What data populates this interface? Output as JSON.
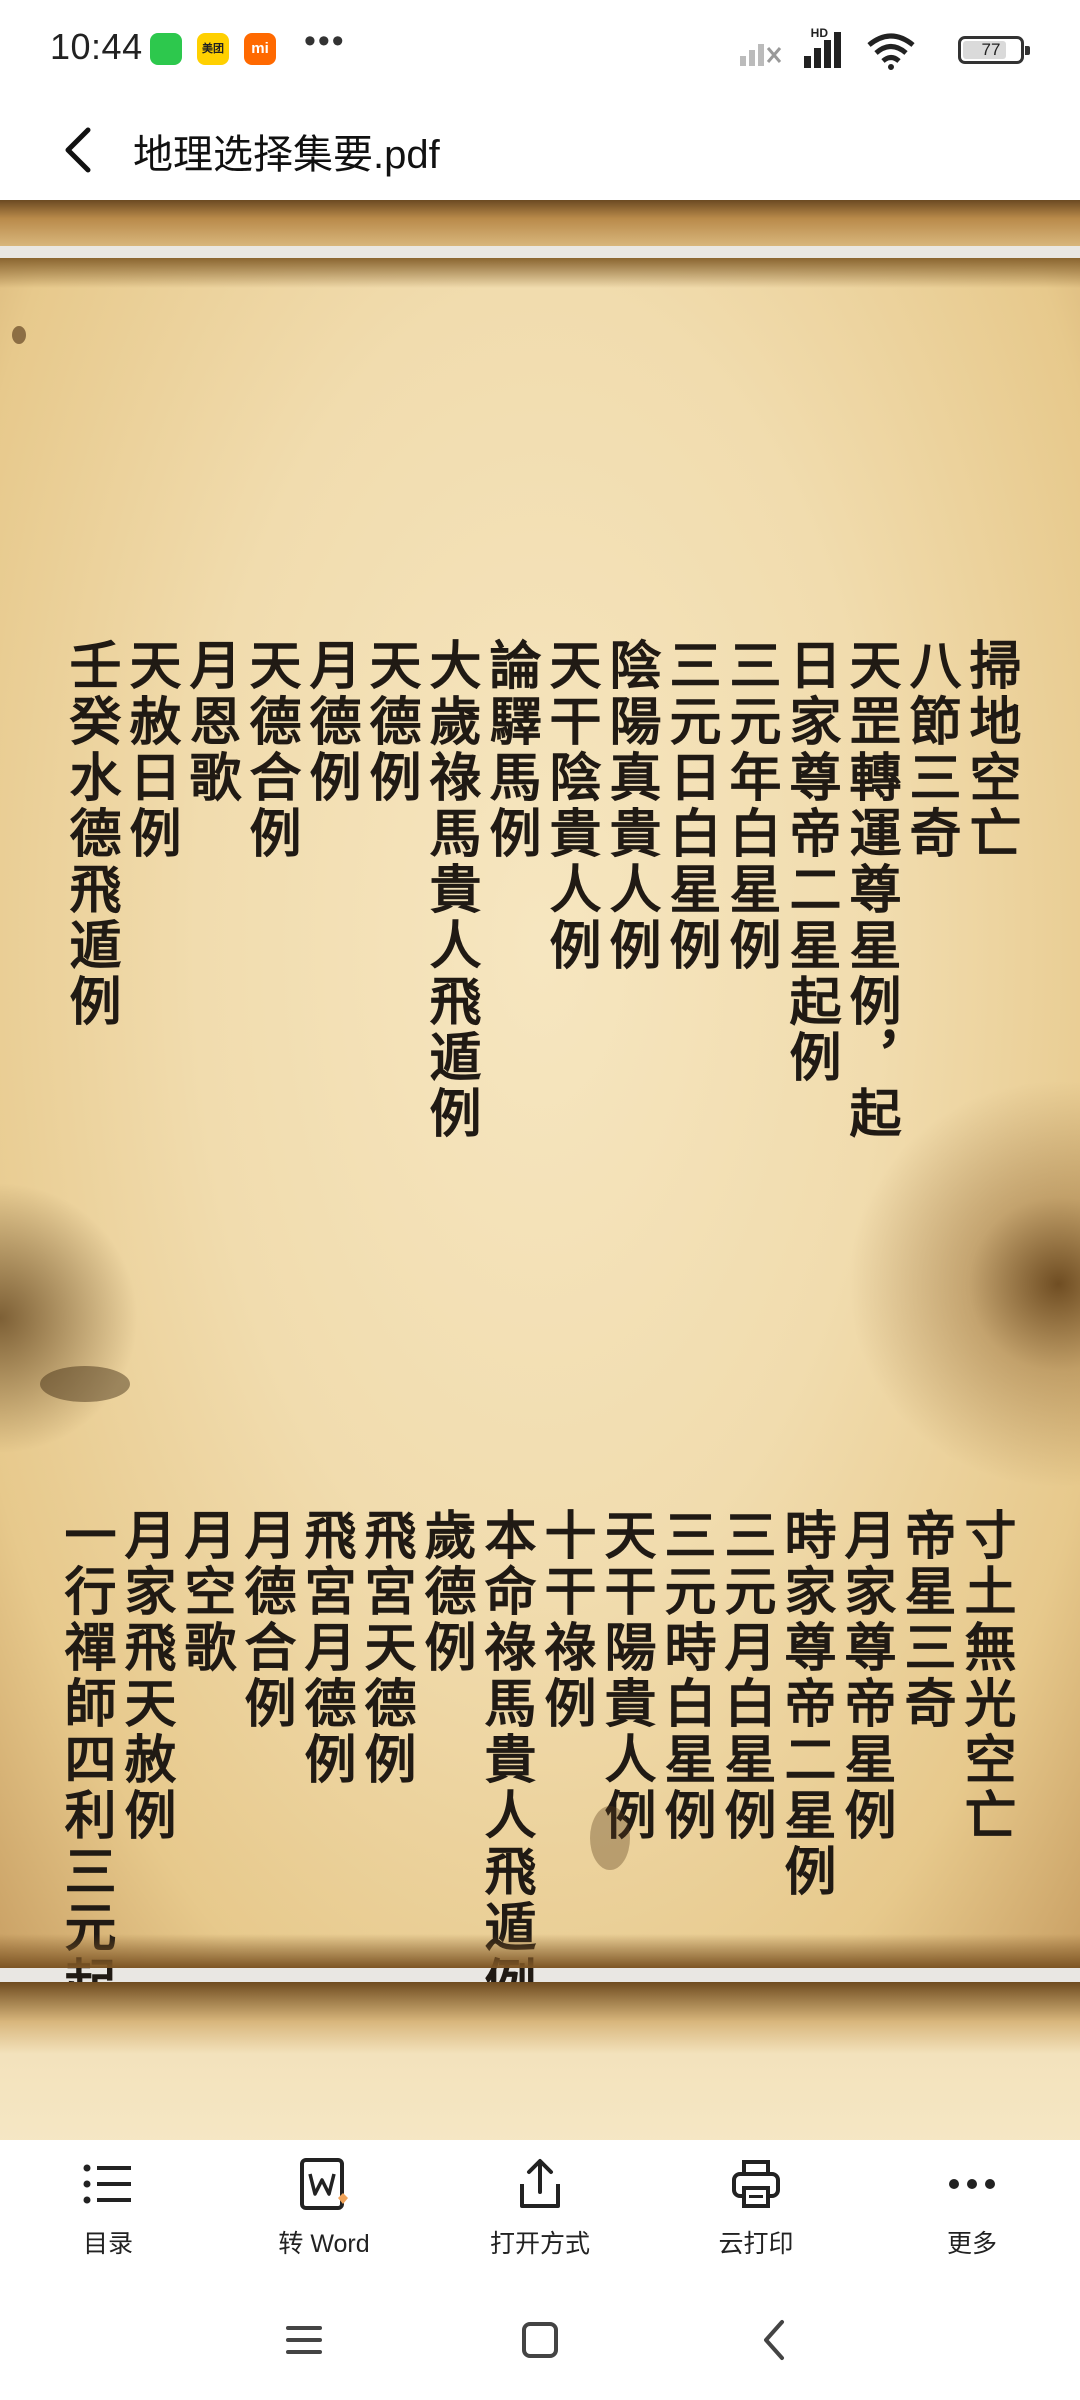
{
  "status_bar": {
    "time": "10:44",
    "app_badges": [
      {
        "name": "wechat-icon",
        "text": ""
      },
      {
        "name": "meituan-icon",
        "text": "美团"
      },
      {
        "name": "mi-icon",
        "text": "mi"
      }
    ],
    "network_label": "HD",
    "battery": "77",
    "battery_level": 0.77
  },
  "header": {
    "title": "地理选择集要.pdf"
  },
  "document": {
    "top_block_columns": [
      "掃地空亡",
      "八節三奇",
      "天罡轉運尊星例，起",
      "日家尊帝二星起例",
      "三元年白星例",
      "三元日白星例",
      "陰陽真貴人例",
      "天干陰貴人例",
      "論驛馬例",
      "大歲祿馬貴人飛遁例",
      "天德例",
      "月德例",
      "天德合例",
      "月恩歌",
      "天赦日例",
      "壬癸水德飛遁例"
    ],
    "bottom_block_columns": [
      "寸土無光空亡",
      "帝星三奇",
      "月家尊帝星例",
      "時家尊帝二星例",
      "三元月白星例",
      "三元時白星例",
      "天干陽貴人例",
      "十干祿例",
      "本命祿馬貴人飛遁例",
      "歲德例",
      "飛宮天德例",
      "飛宮月德例",
      "月德合例",
      "月空歌",
      "月家飛天赦例",
      "一行禪師四利三元起例"
    ]
  },
  "toolbar": {
    "items": [
      {
        "label": "目录",
        "icon": "list-icon"
      },
      {
        "label": "转 Word",
        "icon": "word-icon"
      },
      {
        "label": "打开方式",
        "icon": "share-icon"
      },
      {
        "label": "云打印",
        "icon": "printer-icon"
      },
      {
        "label": "更多",
        "icon": "more-icon"
      }
    ]
  },
  "navbar": {
    "buttons": [
      "menu-icon",
      "home-icon",
      "back-icon"
    ]
  }
}
